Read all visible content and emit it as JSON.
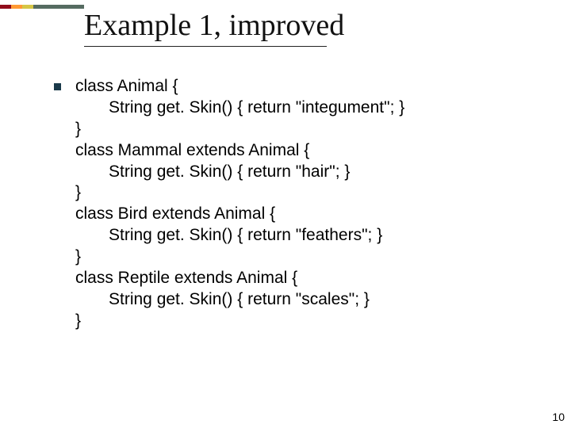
{
  "title": "Example 1, improved",
  "code": {
    "l1": "class Animal {",
    "l2": "String get. Skin() { return \"integument\"; }",
    "l3": "}",
    "l4": "class Mammal extends Animal {",
    "l5": "String get. Skin() { return \"hair\"; }",
    "l6": "}",
    "l7": "class Bird extends Animal {",
    "l8": "String get. Skin() { return \"feathers\"; }",
    "l9": "}",
    "l10": "class Reptile extends Animal {",
    "l11": "String get. Skin() { return \"scales\"; }",
    "l12": "}"
  },
  "page_number": "10"
}
